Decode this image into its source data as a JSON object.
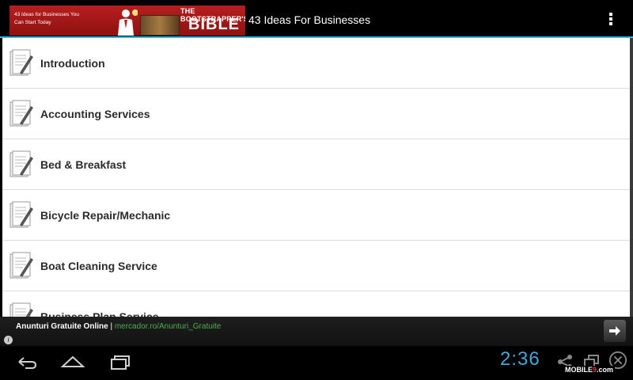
{
  "header": {
    "banner": {
      "left_text": "43 Ideas for Businesses You Can Start Today",
      "title_small": "THE BOOTSTRAPPER'S",
      "title_big": "BIBLE"
    },
    "app_title": "43 Ideas For Businesses"
  },
  "list": {
    "items": [
      {
        "label": "Introduction"
      },
      {
        "label": "Accounting Services"
      },
      {
        "label": "Bed & Breakfast"
      },
      {
        "label": "Bicycle Repair/Mechanic"
      },
      {
        "label": "Boat Cleaning Service"
      },
      {
        "label": "Business Plan Service"
      }
    ]
  },
  "ad": {
    "title": "Anunturi Gratuite Online",
    "separator": " | ",
    "url": "mercador.ro/Anunturi_Gratuite",
    "info_glyph": "i"
  },
  "status": {
    "time": "2:36"
  },
  "watermark": {
    "prefix": "MOBILE",
    "number": "9",
    "suffix": ".com"
  },
  "colors": {
    "accent": "#33b5e5",
    "clock": "#3fa9dc",
    "ad_url": "#4caf50",
    "banner": "#b81e1e"
  }
}
